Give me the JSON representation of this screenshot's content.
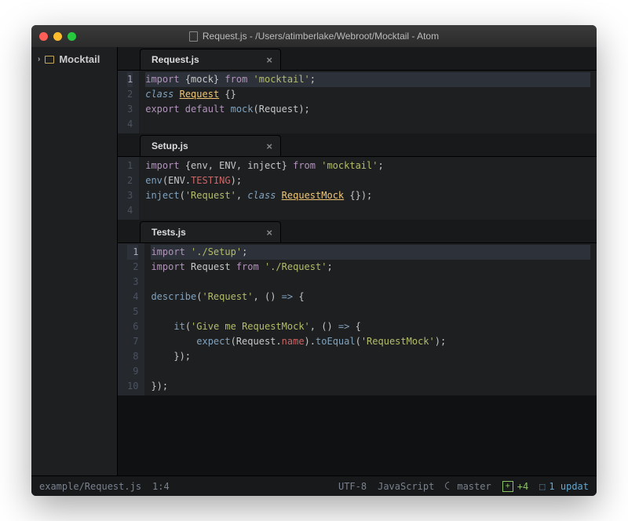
{
  "window": {
    "title": "Request.js - /Users/atimberlake/Webroot/Mocktail - Atom"
  },
  "sidebar": {
    "project": "Mocktail"
  },
  "panes": [
    {
      "tab": "Request.js",
      "highlight_line": 0,
      "lines": [
        [
          {
            "t": "import ",
            "c": "kw"
          },
          {
            "t": "{mock} ",
            "c": "pun"
          },
          {
            "t": "from ",
            "c": "kw"
          },
          {
            "t": "'mocktail'",
            "c": "str"
          },
          {
            "t": ";",
            "c": "pun"
          }
        ],
        [
          {
            "t": "class ",
            "c": "kw2"
          },
          {
            "t": "Request",
            "c": "cls-u"
          },
          {
            "t": " {}",
            "c": "pun"
          }
        ],
        [
          {
            "t": "export default ",
            "c": "kw"
          },
          {
            "t": "mock",
            "c": "fn"
          },
          {
            "t": "(Request);",
            "c": "pun"
          }
        ],
        []
      ]
    },
    {
      "tab": "Setup.js",
      "highlight_line": -1,
      "lines": [
        [
          {
            "t": "import ",
            "c": "kw"
          },
          {
            "t": "{env, ENV, inject} ",
            "c": "pun"
          },
          {
            "t": "from ",
            "c": "kw"
          },
          {
            "t": "'mocktail'",
            "c": "str"
          },
          {
            "t": ";",
            "c": "pun"
          }
        ],
        [
          {
            "t": "env",
            "c": "fn"
          },
          {
            "t": "(ENV",
            "c": "pun"
          },
          {
            "t": ".",
            "c": "pun"
          },
          {
            "t": "TESTING",
            "c": "prop"
          },
          {
            "t": ");",
            "c": "pun"
          }
        ],
        [
          {
            "t": "inject",
            "c": "fn"
          },
          {
            "t": "(",
            "c": "pun"
          },
          {
            "t": "'Request'",
            "c": "str"
          },
          {
            "t": ", ",
            "c": "pun"
          },
          {
            "t": "class ",
            "c": "kw2"
          },
          {
            "t": "RequestMock",
            "c": "cls-u"
          },
          {
            "t": " {});",
            "c": "pun"
          }
        ],
        []
      ]
    },
    {
      "tab": "Tests.js",
      "highlight_line": 0,
      "lines": [
        [
          {
            "t": "import ",
            "c": "kw"
          },
          {
            "t": "'./Setup'",
            "c": "str"
          },
          {
            "t": ";",
            "c": "pun"
          }
        ],
        [
          {
            "t": "import ",
            "c": "kw"
          },
          {
            "t": "Request ",
            "c": "pun"
          },
          {
            "t": "from ",
            "c": "kw"
          },
          {
            "t": "'./Request'",
            "c": "str"
          },
          {
            "t": ";",
            "c": "pun"
          }
        ],
        [],
        [
          {
            "t": "describe",
            "c": "fn"
          },
          {
            "t": "(",
            "c": "pun"
          },
          {
            "t": "'Request'",
            "c": "str"
          },
          {
            "t": ", () ",
            "c": "pun"
          },
          {
            "t": "=>",
            "c": "kw2"
          },
          {
            "t": " {",
            "c": "pun"
          }
        ],
        [],
        [
          {
            "t": "    it",
            "c": "fn"
          },
          {
            "t": "(",
            "c": "pun"
          },
          {
            "t": "'Give me RequestMock'",
            "c": "str"
          },
          {
            "t": ", () ",
            "c": "pun"
          },
          {
            "t": "=>",
            "c": "kw2"
          },
          {
            "t": " {",
            "c": "pun"
          }
        ],
        [
          {
            "t": "        expect",
            "c": "fn"
          },
          {
            "t": "(Request",
            "c": "pun"
          },
          {
            "t": ".",
            "c": "pun"
          },
          {
            "t": "name",
            "c": "prop"
          },
          {
            "t": ")",
            "c": "pun"
          },
          {
            "t": ".",
            "c": "pun"
          },
          {
            "t": "toEqual",
            "c": "fn"
          },
          {
            "t": "(",
            "c": "pun"
          },
          {
            "t": "'RequestMock'",
            "c": "str"
          },
          {
            "t": ");",
            "c": "pun"
          }
        ],
        [
          {
            "t": "    });",
            "c": "pun"
          }
        ],
        [],
        [
          {
            "t": "});",
            "c": "pun"
          }
        ]
      ]
    }
  ],
  "status": {
    "path": "example/Request.js",
    "cursor": "1:4",
    "encoding": "UTF-8",
    "language": "JavaScript",
    "branch": "master",
    "git_plus": "+4",
    "updates": "1 updat"
  }
}
